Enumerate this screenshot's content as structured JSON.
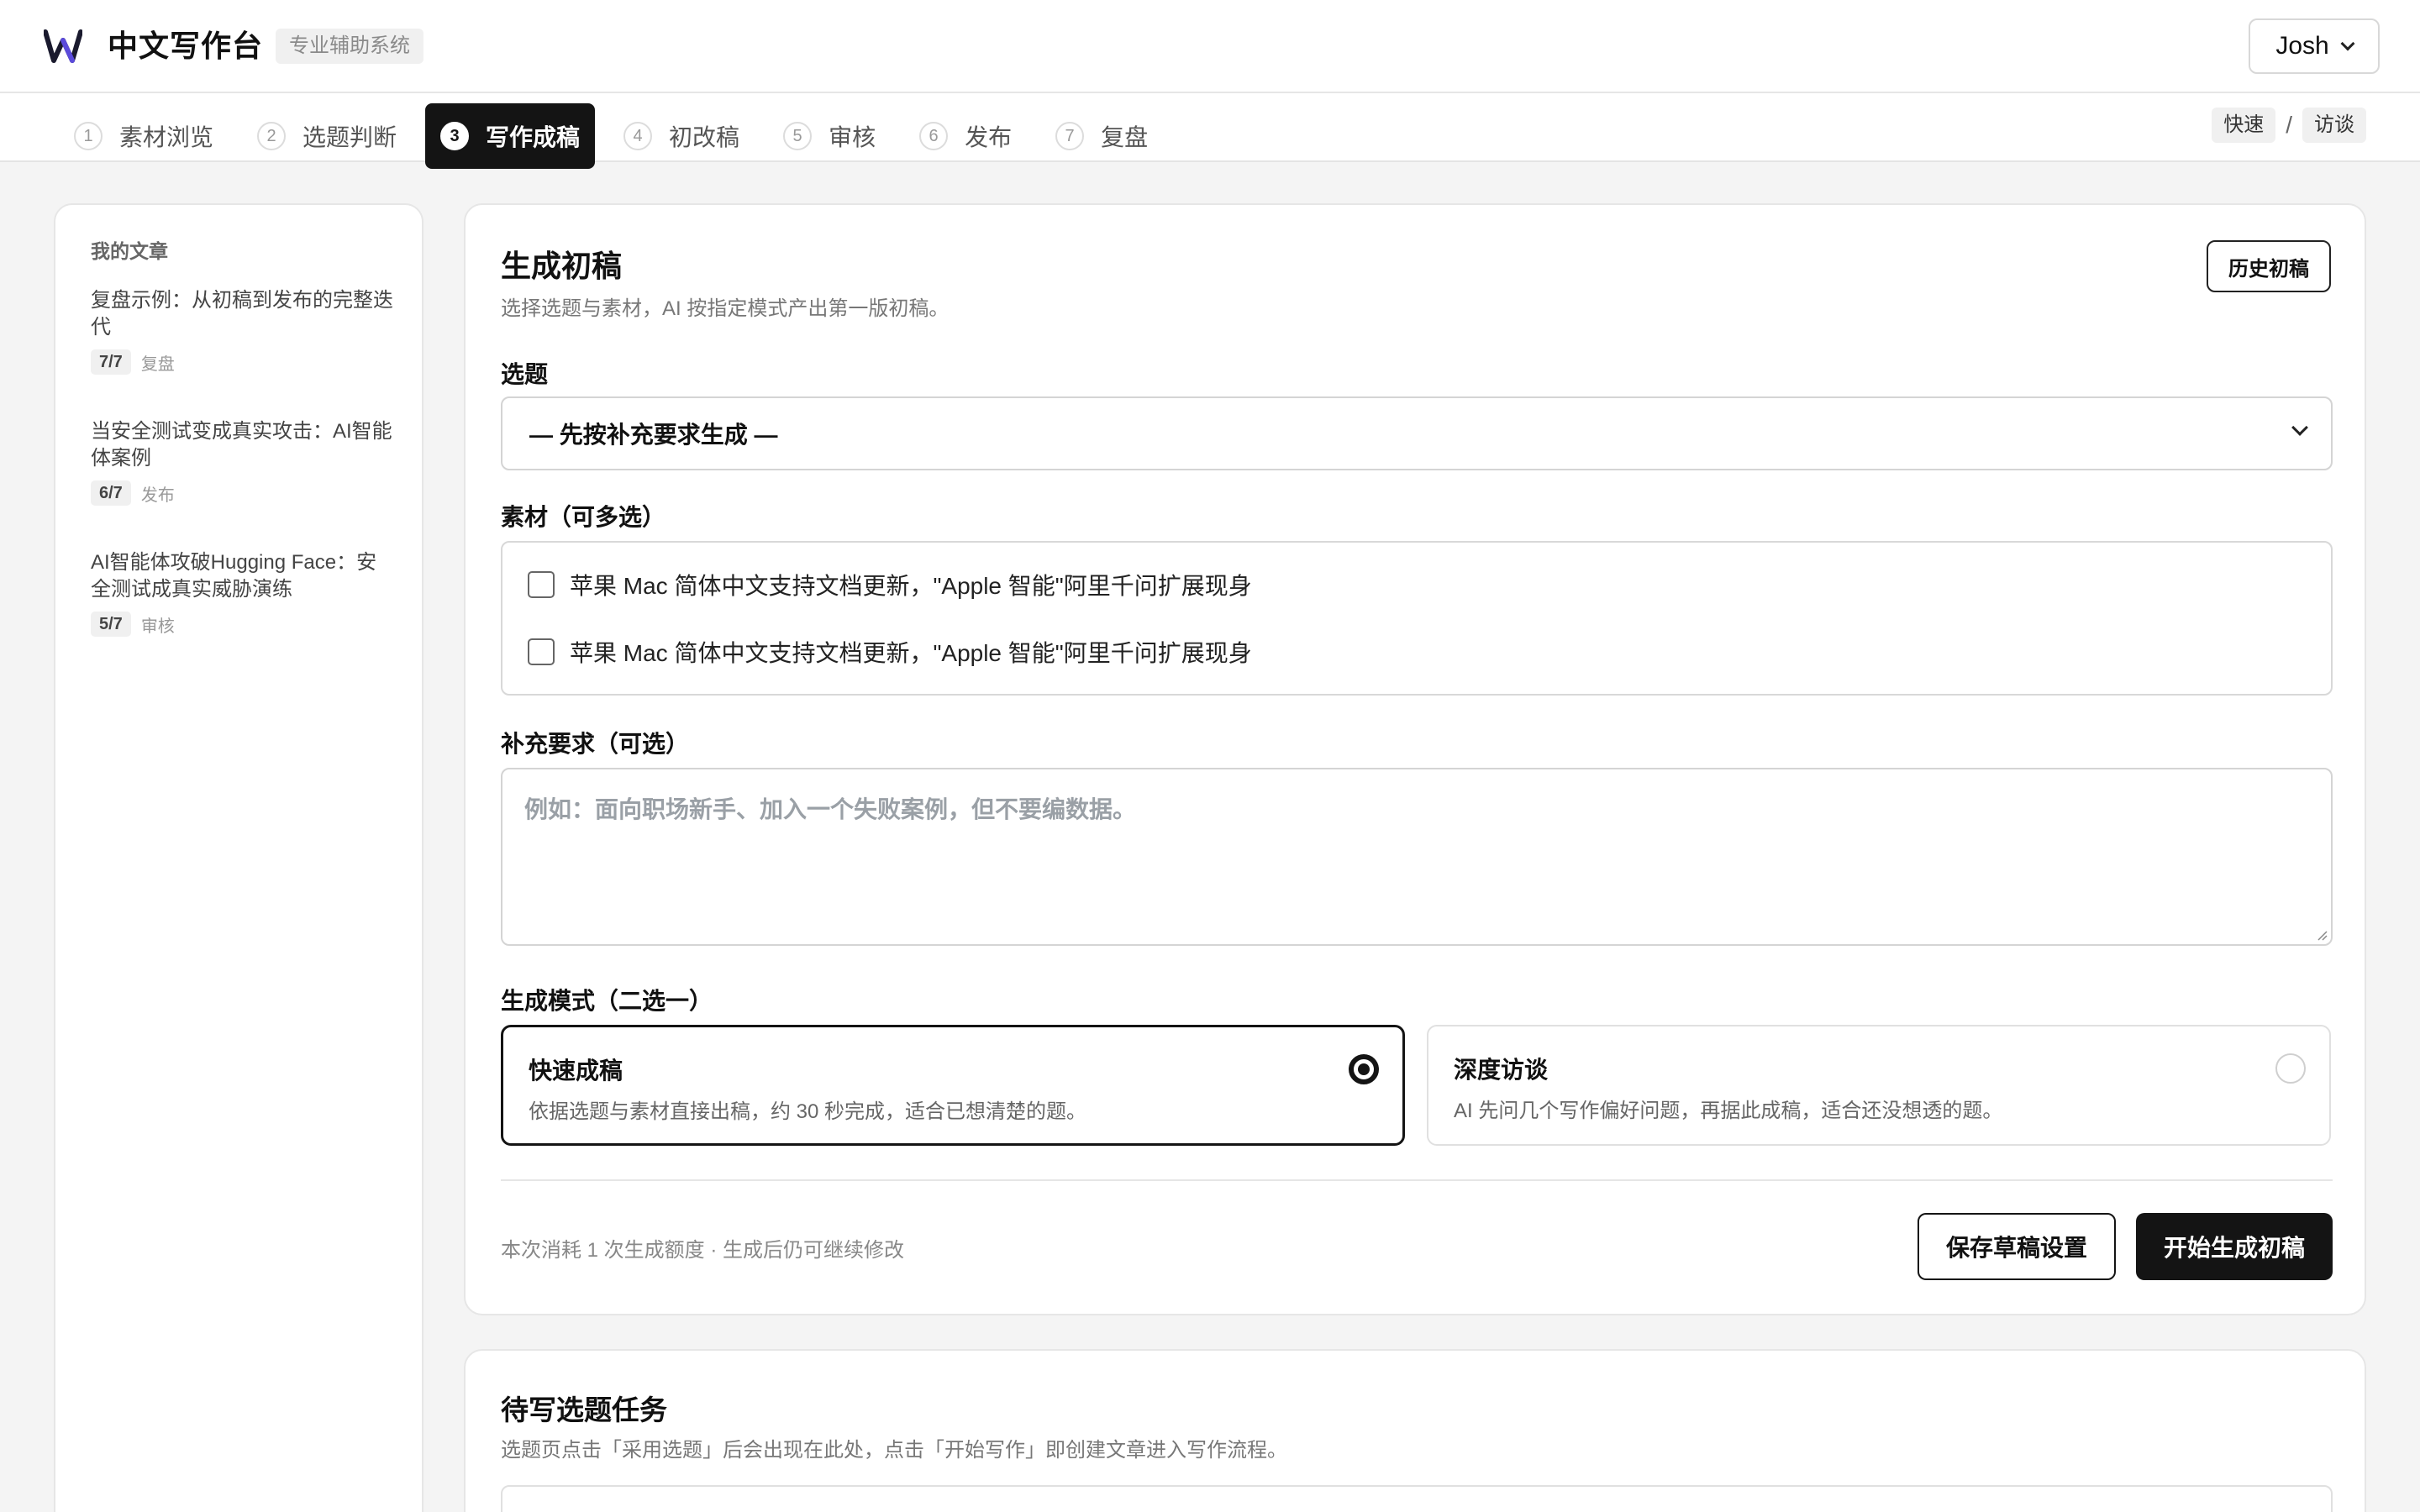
{
  "header": {
    "logo_icon": "w-logo-icon",
    "app_title": "中文写作台",
    "app_badge": "专业辅助系统",
    "user_name": "Josh"
  },
  "steps": [
    {
      "num": "1",
      "label": "素材浏览",
      "active": false
    },
    {
      "num": "2",
      "label": "选题判断",
      "active": false
    },
    {
      "num": "3",
      "label": "写作成稿",
      "active": true
    },
    {
      "num": "4",
      "label": "初改稿",
      "active": false
    },
    {
      "num": "5",
      "label": "审核",
      "active": false
    },
    {
      "num": "6",
      "label": "发布",
      "active": false
    },
    {
      "num": "7",
      "label": "复盘",
      "active": false
    }
  ],
  "mode_switch": {
    "fast": "快速",
    "separator": "/",
    "interview": "访谈"
  },
  "sidebar": {
    "title": "我的文章",
    "articles": [
      {
        "title": "复盘示例：从初稿到发布的完整迭代",
        "progress": "7/7",
        "stage": "复盘"
      },
      {
        "title": "当安全测试变成真实攻击：AI智能体案例",
        "progress": "6/7",
        "stage": "发布"
      },
      {
        "title": "AI智能体攻破Hugging Face：安全测试成真实威胁演练",
        "progress": "5/7",
        "stage": "审核"
      }
    ]
  },
  "main": {
    "title": "生成初稿",
    "subtitle": "选择选题与素材，AI 按指定模式产出第一版初稿。",
    "history_button": "历史初稿",
    "topic_label": "选题",
    "topic_value": "— 先按补充要求生成 —",
    "materials_label": "素材（可多选）",
    "materials": [
      "苹果 Mac 简体中文支持文档更新，\"Apple 智能\"阿里千问扩展现身",
      "苹果 Mac 简体中文支持文档更新，\"Apple 智能\"阿里千问扩展现身"
    ],
    "extra_label": "补充要求（可选）",
    "extra_placeholder": "例如：面向职场新手、加入一个失败案例，但不要编数据。",
    "mode_label": "生成模式（二选一）",
    "modes": [
      {
        "title": "快速成稿",
        "desc": "依据选题与素材直接出稿，约 30 秒完成，适合已想清楚的题。",
        "selected": true
      },
      {
        "title": "深度访谈",
        "desc": "AI 先问几个写作偏好问题，再据此成稿，适合还没想透的题。",
        "selected": false
      }
    ],
    "footnote": "本次消耗 1 次生成额度 · 生成后仍可继续修改",
    "save_button": "保存草稿设置",
    "start_button": "开始生成初稿"
  },
  "pending": {
    "title": "待写选题任务",
    "subtitle": "选题页点击「采用选题」后会出现在此处，点击「开始写作」即创建文章进入写作流程。"
  }
}
